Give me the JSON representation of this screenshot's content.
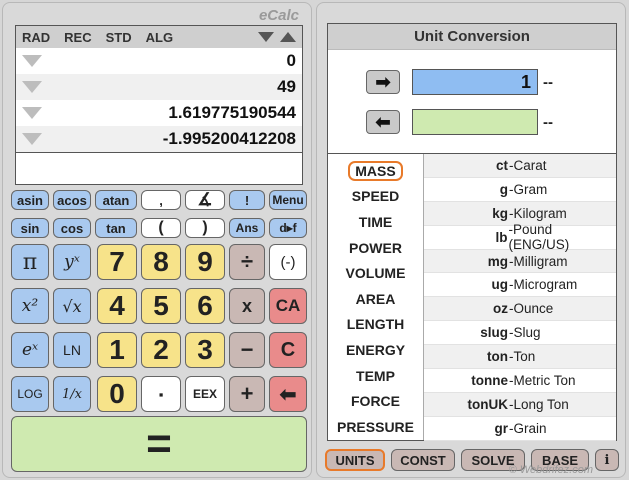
{
  "app_title": "eCalc",
  "display": {
    "modes": [
      "RAD",
      "REC",
      "STD",
      "ALG"
    ],
    "stack": [
      "0",
      "49",
      "1.619775190544",
      "-1.995200412208"
    ],
    "entry": ""
  },
  "keypad": {
    "row1": [
      "asin",
      "acos",
      "atan",
      ",",
      "∡",
      "!",
      "Menu"
    ],
    "row2": [
      "sin",
      "cos",
      "tan",
      "(",
      ")",
      "Ans",
      "d▸f"
    ],
    "row3": [
      "π",
      "yˣ",
      "7",
      "8",
      "9",
      "÷",
      "(-)"
    ],
    "row4": [
      "x²",
      "√x",
      "4",
      "5",
      "6",
      "x",
      "CA"
    ],
    "row5": [
      "eˣ",
      "LN",
      "1",
      "2",
      "3",
      "−",
      "C"
    ],
    "row6": [
      "LOG",
      "1/x",
      "0",
      "▪",
      "EEX",
      "+",
      "⬅"
    ],
    "equals": "="
  },
  "conversion": {
    "title": "Unit Conversion",
    "from_value": "1",
    "to_value": "",
    "from_unit": "--",
    "to_unit": "--",
    "right_arrow": "➡",
    "left_arrow": "⬅",
    "categories": [
      "MASS",
      "SPEED",
      "TIME",
      "POWER",
      "VOLUME",
      "AREA",
      "LENGTH",
      "ENERGY",
      "TEMP",
      "FORCE",
      "PRESSURE"
    ],
    "selected_category": "MASS",
    "units": [
      {
        "abbr": "ct",
        "name": "-Carat"
      },
      {
        "abbr": "g",
        "name": "-Gram"
      },
      {
        "abbr": "kg",
        "name": "-Kilogram"
      },
      {
        "abbr": "lb",
        "name": "-Pound (ENG/US)"
      },
      {
        "abbr": "mg",
        "name": "-Milligram"
      },
      {
        "abbr": "ug",
        "name": "-Microgram"
      },
      {
        "abbr": "oz",
        "name": "-Ounce"
      },
      {
        "abbr": "slug",
        "name": "-Slug"
      },
      {
        "abbr": "ton",
        "name": "-Ton"
      },
      {
        "abbr": "tonne",
        "name": "-Metric Ton"
      },
      {
        "abbr": "tonUK",
        "name": "-Long Ton"
      },
      {
        "abbr": "gr",
        "name": "-Grain"
      }
    ]
  },
  "tabs": [
    "UNITS",
    "CONST",
    "SOLVE",
    "BASE",
    "i"
  ],
  "active_tab": "UNITS",
  "watermark": "© Webdrifez.com",
  "colors": {
    "blue_key": "#a9c9ef",
    "yellow_key": "#f7e38a",
    "red_key": "#e98b8b",
    "green_key": "#cfeab0",
    "mauve_key": "#c9b8b4",
    "accent_outline": "#e87a2a"
  }
}
